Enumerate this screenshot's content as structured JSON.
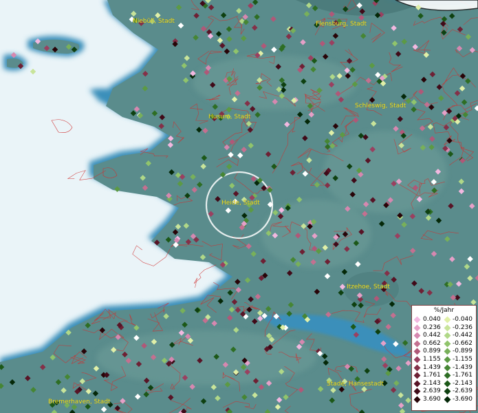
{
  "map": {
    "cities": [
      {
        "name": "Niebüll, Stadt"
      },
      {
        "name": "Flensburg, Stadt"
      },
      {
        "name": "Schleswig, Stadt"
      },
      {
        "name": "Husum, Stadt"
      },
      {
        "name": "Heide, Stadt"
      },
      {
        "name": "Itzehoe, Stadt"
      },
      {
        "name": "Stade, Hansestadt"
      },
      {
        "name": "Bremerhaven, Stadt"
      }
    ],
    "colors": {
      "sea": "#eaf4f8",
      "coast": "#3b8fb8",
      "land": "#5a8c8c",
      "border": "#d03030",
      "city_label": "#f0e020"
    }
  },
  "legend": {
    "title": "%/Jahr",
    "positive": [
      {
        "value": "0.040",
        "color": "#f2b8e0"
      },
      {
        "value": "0.236",
        "color": "#e6a0c8"
      },
      {
        "value": "0.442",
        "color": "#d688b0"
      },
      {
        "value": "0.662",
        "color": "#c47090"
      },
      {
        "value": "0.899",
        "color": "#b05878"
      },
      {
        "value": "1.155",
        "color": "#9a4060"
      },
      {
        "value": "1.439",
        "color": "#843048"
      },
      {
        "value": "1.761",
        "color": "#6e2034"
      },
      {
        "value": "2.143",
        "color": "#581426"
      },
      {
        "value": "2.639",
        "color": "#400a18"
      },
      {
        "value": "3.690",
        "color": "#280408"
      }
    ],
    "negative": [
      {
        "value": "-0.040",
        "color": "#e0f0a8"
      },
      {
        "value": "-0.236",
        "color": "#c8e49a"
      },
      {
        "value": "-0.442",
        "color": "#b0d888"
      },
      {
        "value": "-0.662",
        "color": "#90c46c"
      },
      {
        "value": "-0.899",
        "color": "#78b05a"
      },
      {
        "value": "-1.155",
        "color": "#5c9a44"
      },
      {
        "value": "-1.439",
        "color": "#468634"
      },
      {
        "value": "-1.761",
        "color": "#2e6e24"
      },
      {
        "value": "-2.143",
        "color": "#1c5818"
      },
      {
        "value": "-2.639",
        "color": "#0e4010"
      },
      {
        "value": "-3.690",
        "color": "#042808"
      }
    ]
  }
}
